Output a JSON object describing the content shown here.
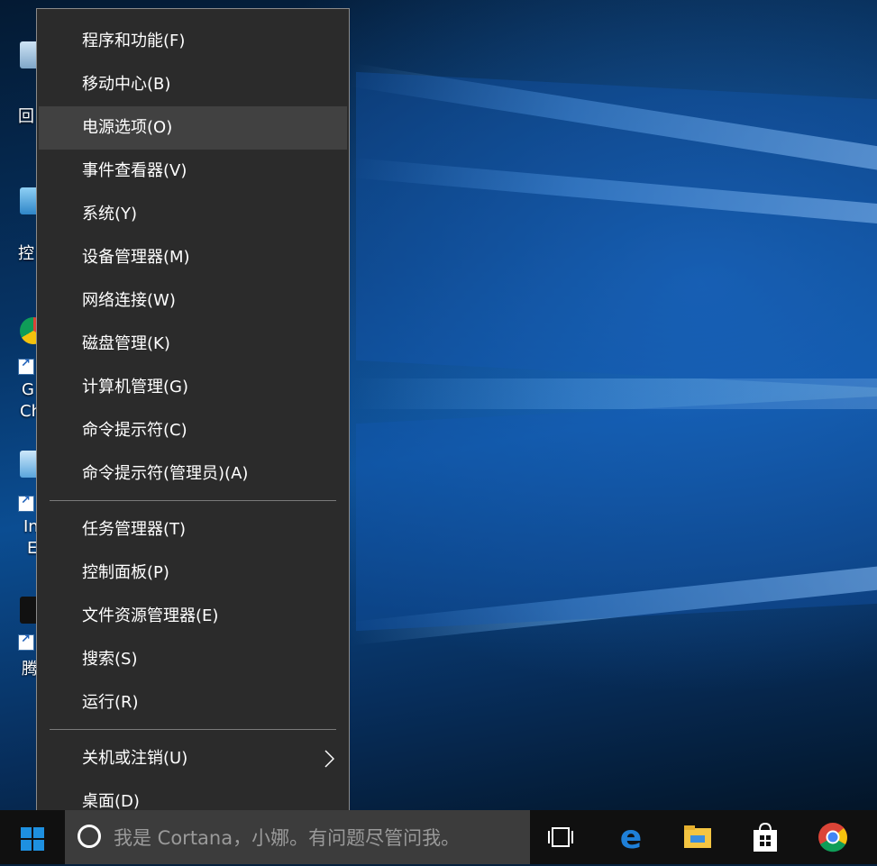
{
  "desktop": {
    "icons": [
      {
        "name": "recycle-bin",
        "label": "回"
      },
      {
        "name": "control-panel",
        "label": "控"
      },
      {
        "name": "google-chrome",
        "label": "G",
        "label2": "Ch"
      },
      {
        "name": "internet-explorer",
        "label": "In",
        "label2": "E"
      },
      {
        "name": "tencent",
        "label": "腾"
      }
    ]
  },
  "context_menu": {
    "items": [
      {
        "label": "程序和功能(F)"
      },
      {
        "label": "移动中心(B)"
      },
      {
        "label": "电源选项(O)",
        "highlighted": true
      },
      {
        "label": "事件查看器(V)"
      },
      {
        "label": "系统(Y)"
      },
      {
        "label": "设备管理器(M)"
      },
      {
        "label": "网络连接(W)"
      },
      {
        "label": "磁盘管理(K)"
      },
      {
        "label": "计算机管理(G)"
      },
      {
        "label": "命令提示符(C)"
      },
      {
        "label": "命令提示符(管理员)(A)"
      },
      {
        "label": "任务管理器(T)"
      },
      {
        "label": "控制面板(P)"
      },
      {
        "label": "文件资源管理器(E)"
      },
      {
        "label": "搜索(S)"
      },
      {
        "label": "运行(R)"
      },
      {
        "label": "关机或注销(U)",
        "has_submenu": true
      },
      {
        "label": "桌面(D)"
      }
    ]
  },
  "taskbar": {
    "search_placeholder": "我是 Cortana，小娜。有问题尽管问我。",
    "pinned": [
      "task-view-icon",
      "edge-icon",
      "file-explorer-icon",
      "store-icon",
      "chrome-icon"
    ]
  },
  "colors": {
    "menu_bg": "#2b2b2b",
    "menu_highlight": "#414141",
    "taskbar_bg": "#101010",
    "search_bg": "#3c3c3c",
    "windows_blue": "#1e90e0"
  }
}
